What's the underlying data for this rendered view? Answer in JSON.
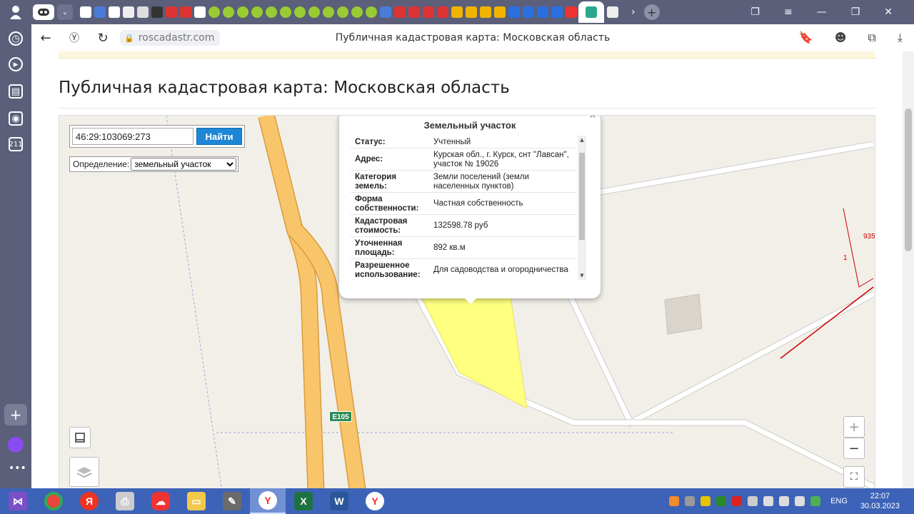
{
  "browser": {
    "tab_count_label": "",
    "url": "roscadastr.com",
    "page_title": "Публичная кадастровая карта: Московская область"
  },
  "page": {
    "heading": "Публичная кадастровая карта: Московская область",
    "search": {
      "value": "46:29:103069:273",
      "button_label": "Найти"
    },
    "definition": {
      "label": "Определение:",
      "selected": "земельный участок"
    },
    "map": {
      "road_label": "E105",
      "parcel_numbers": [
        "935",
        "1"
      ],
      "zoom_in": "+",
      "zoom_out": "−"
    },
    "popup": {
      "title": "Земельный участок",
      "close": "×",
      "rows": [
        {
          "key": "Статус:",
          "value": "Учтенный"
        },
        {
          "key": "Адрес:",
          "value": "Курская обл., г. Курск, снт \"Лавсан\", участок № 19026"
        },
        {
          "key": "Категория земель:",
          "value": "Земли поселений (земли населенных пунктов)"
        },
        {
          "key": "Форма собственности:",
          "value": "Частная собственность"
        },
        {
          "key": "Кадастровая стоимость:",
          "value": "132598.78 руб"
        },
        {
          "key": "Уточненная площадь:",
          "value": "892 кв.м"
        },
        {
          "key": "Разрешенное использование:",
          "value": "Для садоводства и огородничества"
        }
      ]
    }
  },
  "taskbar": {
    "language": "ENG",
    "time": "22:07",
    "date": "30.03.2023"
  },
  "colors": {
    "chrome": "#5b5f7a",
    "taskbar": "#3d63b8",
    "parcel": "#ffff80",
    "road": "#f9c56a",
    "find_button": "#1d87d6"
  }
}
